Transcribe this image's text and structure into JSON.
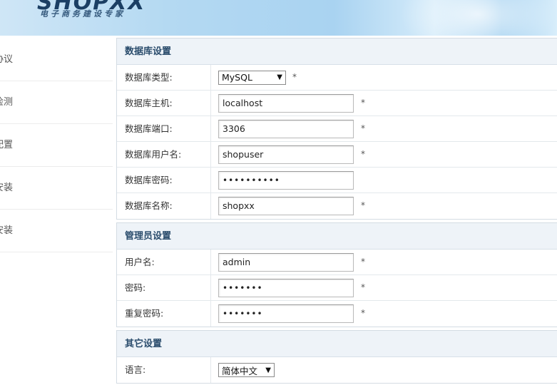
{
  "header": {
    "logo": "SHOPXX",
    "tagline": "电子商务建设专家"
  },
  "sidebar": {
    "items": [
      {
        "label": "协议"
      },
      {
        "label": "检测"
      },
      {
        "label": "配置"
      },
      {
        "label": "安装"
      },
      {
        "label": "安装"
      }
    ]
  },
  "sections": [
    {
      "title": "数据库设置",
      "rows": [
        {
          "label": "数据库类型:",
          "value": "MySQL",
          "required": "*"
        },
        {
          "label": "数据库主机:",
          "value": "localhost",
          "required": "*"
        },
        {
          "label": "数据库端口:",
          "value": "3306",
          "required": "*"
        },
        {
          "label": "数据库用户名:",
          "value": "shopuser",
          "required": "*"
        },
        {
          "label": "数据库密码:",
          "value": "••••••••••",
          "required": ""
        },
        {
          "label": "数据库名称:",
          "value": "shopxx",
          "required": "*"
        }
      ]
    },
    {
      "title": "管理员设置",
      "rows": [
        {
          "label": "用户名:",
          "value": "admin",
          "required": "*"
        },
        {
          "label": "密码:",
          "value": "•••••••",
          "required": "*"
        },
        {
          "label": "重复密码:",
          "value": "•••••••",
          "required": "*"
        }
      ]
    },
    {
      "title": "其它设置",
      "rows": [
        {
          "label": "语言:",
          "value": "简体中文",
          "required": ""
        }
      ]
    }
  ],
  "icons": {
    "dropdown": "chevron-down-icon"
  }
}
